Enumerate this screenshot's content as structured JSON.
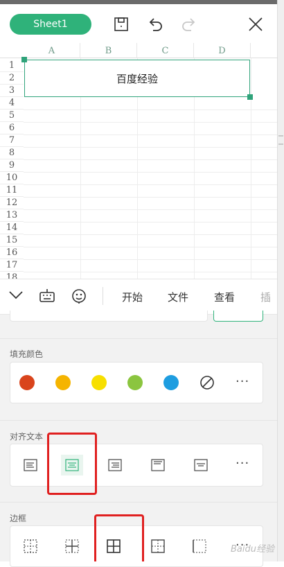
{
  "header": {
    "sheet_tab": "Sheet1"
  },
  "grid": {
    "columns": [
      "A",
      "B",
      "C",
      "D"
    ],
    "rows": [
      "1",
      "2",
      "3",
      "4",
      "5",
      "6",
      "7",
      "8",
      "9",
      "10",
      "11",
      "12",
      "13",
      "14",
      "15",
      "16",
      "17",
      "18"
    ],
    "merged_cell_text": "百度经验"
  },
  "tabbar": {
    "tabs": [
      "开始",
      "文件",
      "查看",
      "插"
    ],
    "active_tab": "开始"
  },
  "panel": {
    "fill_label": "填充颜色",
    "fill_colors": [
      "#d9441c",
      "#f5b400",
      "#f7df00",
      "#8bc53f",
      "#1e9de0"
    ],
    "align_label": "对齐文本",
    "border_label": "边框",
    "more_glyph": "···"
  },
  "highlight_color": "#e02020",
  "accent_color": "#2fb27a",
  "watermark": "Baidu经验"
}
